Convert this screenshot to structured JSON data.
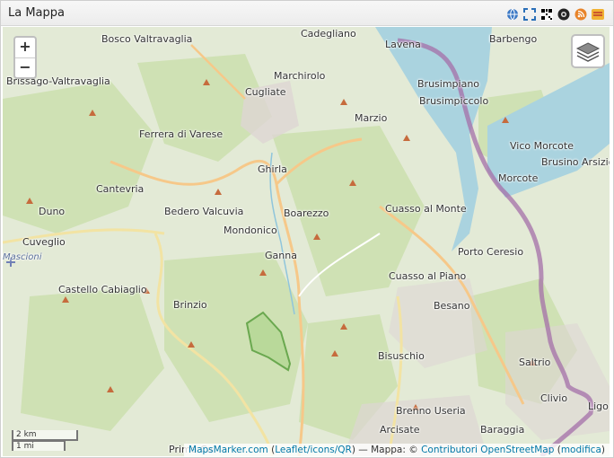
{
  "widget": {
    "title": "La Mappa"
  },
  "header_icons": [
    "globe-icon",
    "fullscreen-icon",
    "qr-code-icon",
    "ar-browser-icon",
    "rss-feed-icon",
    "kml-icon"
  ],
  "controls": {
    "zoom_in": "+",
    "zoom_out": "−"
  },
  "scale": {
    "km": "2 km",
    "mi": "1 mi"
  },
  "attribution": {
    "mapsmarker": "MapsMarker.com",
    "paren_open": " (",
    "leaflet": "Leaflet/icons/QR",
    "paren_close": ") — Mappa: © ",
    "osm": "Contributori OpenStreetMap",
    "modifica": "modifica"
  },
  "places": [
    "Bosco Valtravaglia",
    "Cadegliano",
    "Lavena",
    "Barbengo",
    "Brissago-Valtravaglia",
    "Marchirolo",
    "Brusimpiano",
    "Cugliate",
    "Brusimpiccolo",
    "Marzio",
    "Ferrera di Varese",
    "Vico Morcote",
    "Brusino Arsizio",
    "Ghirla",
    "Morcote",
    "Cantevria",
    "Duno",
    "Bedero Valcuvia",
    "Boarezzo",
    "Cuasso al Monte",
    "Mondonico",
    "Cuveglio",
    "Ganna",
    "Porto Ceresio",
    "Mascioni",
    "Cuasso al Piano",
    "Castello Cabiaglio",
    "Brinzio",
    "Besano",
    "Bisuschio",
    "Saltrio",
    "Clivio",
    "Brenno Useria",
    "Ligo",
    "Arcisate",
    "Baraggia",
    "Prima Ca"
  ]
}
